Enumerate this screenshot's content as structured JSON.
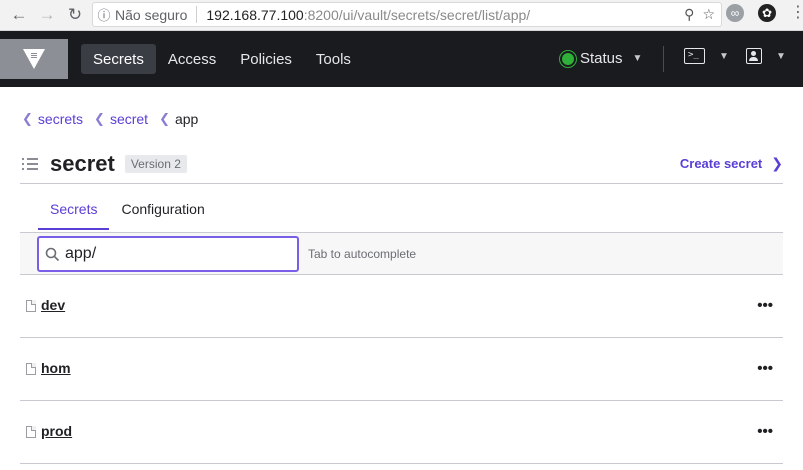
{
  "browser": {
    "back_icon": "arrow-left-icon",
    "forward_icon": "arrow-right-icon",
    "reload_icon": "reload-icon",
    "security_label": "Não seguro",
    "url_host": "192.168.77.100",
    "url_rest": ":8200/ui/vault/secrets/secret/list/app/"
  },
  "topnav": {
    "links": [
      {
        "label": "Secrets",
        "active": true
      },
      {
        "label": "Access",
        "active": false
      },
      {
        "label": "Policies",
        "active": false
      },
      {
        "label": "Tools",
        "active": false
      }
    ],
    "status_label": "Status",
    "status_color": "#2eb039",
    "console_glyph": ">_"
  },
  "breadcrumb": {
    "items": [
      {
        "label": "secrets"
      },
      {
        "label": "secret"
      },
      {
        "label": "app"
      }
    ]
  },
  "header": {
    "title": "secret",
    "version_badge": "Version 2",
    "create_link": "Create secret"
  },
  "tabs": [
    {
      "label": "Secrets",
      "active": true
    },
    {
      "label": "Configuration",
      "active": false
    }
  ],
  "filter": {
    "value": "app/",
    "hint": "Tab to autocomplete"
  },
  "secrets": [
    {
      "name": "dev",
      "menu": "•••"
    },
    {
      "name": "hom",
      "menu": "•••"
    },
    {
      "name": "prod",
      "menu": "•••"
    }
  ],
  "colors": {
    "accent": "#5b3ed6",
    "nav_bg": "#1a1b1f"
  }
}
